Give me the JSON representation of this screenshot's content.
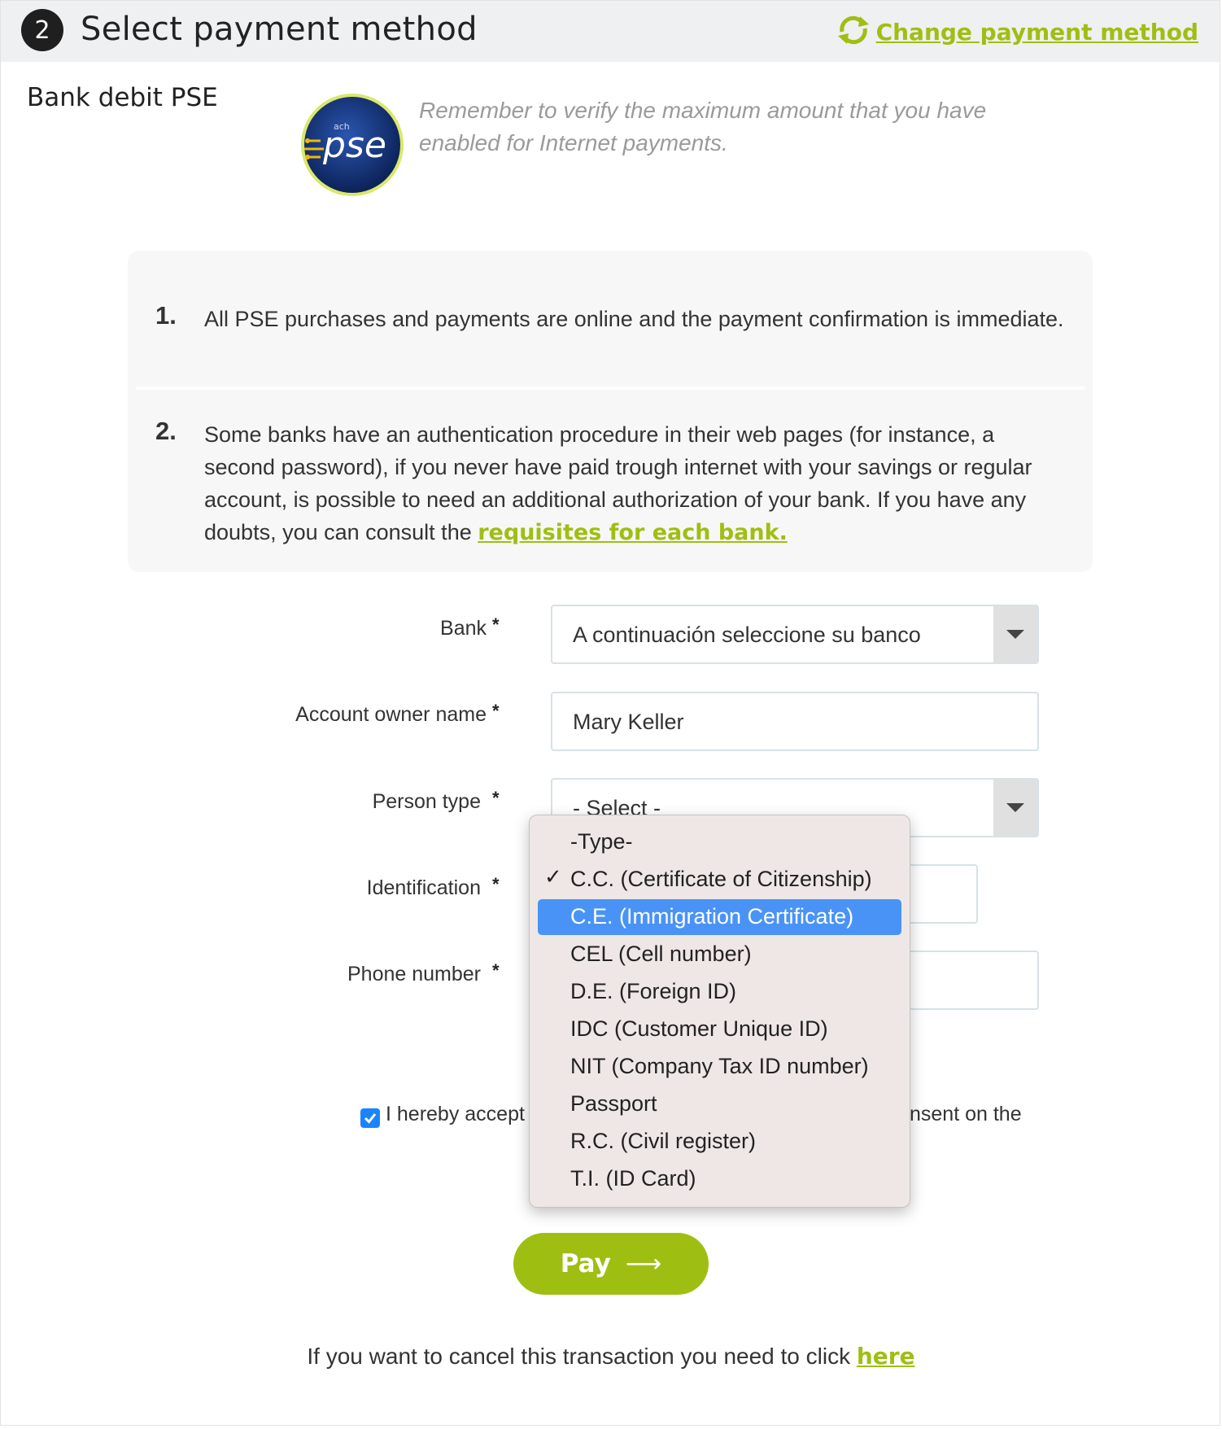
{
  "header": {
    "step_number": "2",
    "title": "Select payment method",
    "change_link": "Change payment method"
  },
  "method": {
    "label": "Bank debit PSE",
    "logo_small": "ach",
    "logo_text": "pse",
    "reminder": "Remember to verify the maximum amount that you have enabled for Internet payments."
  },
  "info": {
    "items": [
      {
        "number": "1.",
        "text": "All PSE purchases and payments are online and the payment confirmation is immediate."
      },
      {
        "number": "2.",
        "text": "Some banks have an authentication procedure in their web pages (for instance, a second password), if you never have paid trough internet with your savings or regular account, is possible to need an additional authorization of your bank. If you have any doubts, you can consult the ",
        "link": "requisites for each bank."
      }
    ]
  },
  "form": {
    "required_mark": "*",
    "bank": {
      "label": "Bank",
      "value": "A continuación seleccione su banco"
    },
    "owner": {
      "label": "Account owner name",
      "value": "Mary Keller"
    },
    "person_type": {
      "label": "Person type",
      "value": "- Select -"
    },
    "identification": {
      "label": "Identification"
    },
    "phone": {
      "label": "Phone number"
    }
  },
  "consent": {
    "checked": true,
    "text_left": "I hereby accept",
    "text_right": "nsent on the"
  },
  "pay_button": {
    "label": "Pay",
    "arrow": "⟶"
  },
  "cancel": {
    "text": "If you want to cancel this transaction you need to click ",
    "link": "here"
  },
  "dropdown": {
    "check_glyph": "✓",
    "options": [
      {
        "label": "-Type-",
        "checked": false,
        "highlighted": false
      },
      {
        "label": "C.C. (Certificate of Citizenship)",
        "checked": true,
        "highlighted": false
      },
      {
        "label": "C.E. (Immigration Certificate)",
        "checked": false,
        "highlighted": true
      },
      {
        "label": "CEL (Cell number)",
        "checked": false,
        "highlighted": false
      },
      {
        "label": "D.E. (Foreign ID)",
        "checked": false,
        "highlighted": false
      },
      {
        "label": "IDC (Customer Unique ID)",
        "checked": false,
        "highlighted": false
      },
      {
        "label": "NIT (Company Tax ID number)",
        "checked": false,
        "highlighted": false
      },
      {
        "label": "Passport",
        "checked": false,
        "highlighted": false
      },
      {
        "label": "R.C. (Civil register)",
        "checked": false,
        "highlighted": false
      },
      {
        "label": "T.I. (ID Card)",
        "checked": false,
        "highlighted": false
      }
    ]
  },
  "colors": {
    "accent_green": "#9ebf12",
    "highlight_blue": "#4a93f6",
    "logo_navy": "#12306f"
  },
  "icons": {
    "change": "refresh-arrows-icon",
    "dropdown": "caret-down-icon",
    "checkbox": "checkmark-icon"
  }
}
